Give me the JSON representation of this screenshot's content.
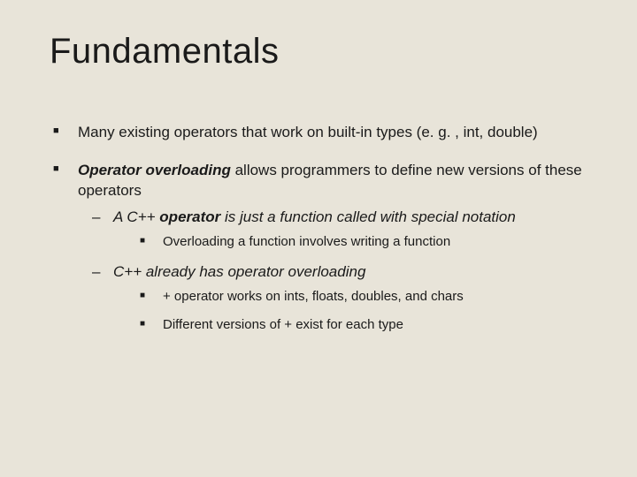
{
  "title": "Fundamentals",
  "bullets": {
    "b1": "Many existing operators that work on built-in types (e. g. , int, double)",
    "b2_bold": "Operator overloading",
    "b2_rest": " allows programmers to define new versions of these operators",
    "b2_s1_pre": "A C++ ",
    "b2_s1_bold": "operator",
    "b2_s1_post": " is just a function called with special notation",
    "b2_s1_s1": "Overloading a function involves writing a function",
    "b2_s2": "C++ already has operator overloading",
    "b2_s2_s1": "+ operator works on ints, floats, doubles, and chars",
    "b2_s2_s2": "Different versions of + exist for each type"
  }
}
